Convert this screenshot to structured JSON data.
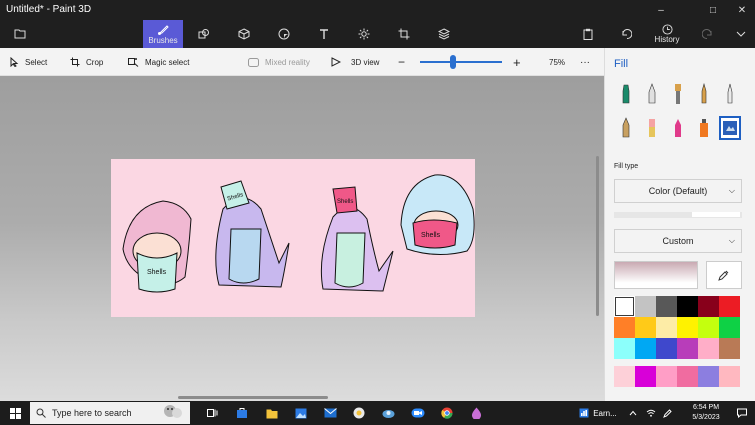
{
  "window": {
    "title": "Untitled* - Paint 3D",
    "minimize_glyph": "–",
    "maximize_glyph": "□",
    "close_glyph": "✕"
  },
  "ribbon": {
    "brushes_label": "Brushes",
    "history_label": "History"
  },
  "toolbar": {
    "select_label": "Select",
    "crop_label": "Crop",
    "magic_select_label": "Magic select",
    "mixed_reality_label": "Mixed reality",
    "view_3d_label": "3D view",
    "zoom_level": "75%",
    "zoom_fraction": 0.4,
    "more_glyph": "···"
  },
  "panel": {
    "title": "Fill",
    "fill_type_label": "Fill type",
    "fill_type_value": "Color (Default)",
    "color_mode_value": "Custom",
    "tools": [
      "marker-icon",
      "calligraphy-pen-icon",
      "oil-brush-icon",
      "watercolor-icon",
      "pixel-pen-icon",
      "pencil-icon",
      "eraser-icon",
      "crayon-icon",
      "spray-can-icon",
      "fill-icon"
    ],
    "palette": [
      "#ffffff",
      "#c3c3c3",
      "#585858",
      "#000000",
      "#88001b",
      "#ec1c24",
      "#ff7f27",
      "#ffca18",
      "#fdeca6",
      "#fff200",
      "#c4ff0e",
      "#0ed145",
      "#8cfffb",
      "#00a8f3",
      "#3f48cc",
      "#b83dba",
      "#ffaec8",
      "#b97a56"
    ],
    "custom_colors": [
      "#fdd0d8",
      "#d800d8",
      "#ff9ec6",
      "#f06ca0",
      "#8c7ee0",
      "#ffb8c0"
    ]
  },
  "taskbar": {
    "search_placeholder": "Type here to search",
    "earn_label": "Earn...",
    "time": "6:54 PM",
    "date": "5/3/2023"
  },
  "canvas": {
    "background_color": "#fbd7e3",
    "label_1": "Shells",
    "label_2": "Shells",
    "label_3": "Shells",
    "label_4": "Shells"
  }
}
